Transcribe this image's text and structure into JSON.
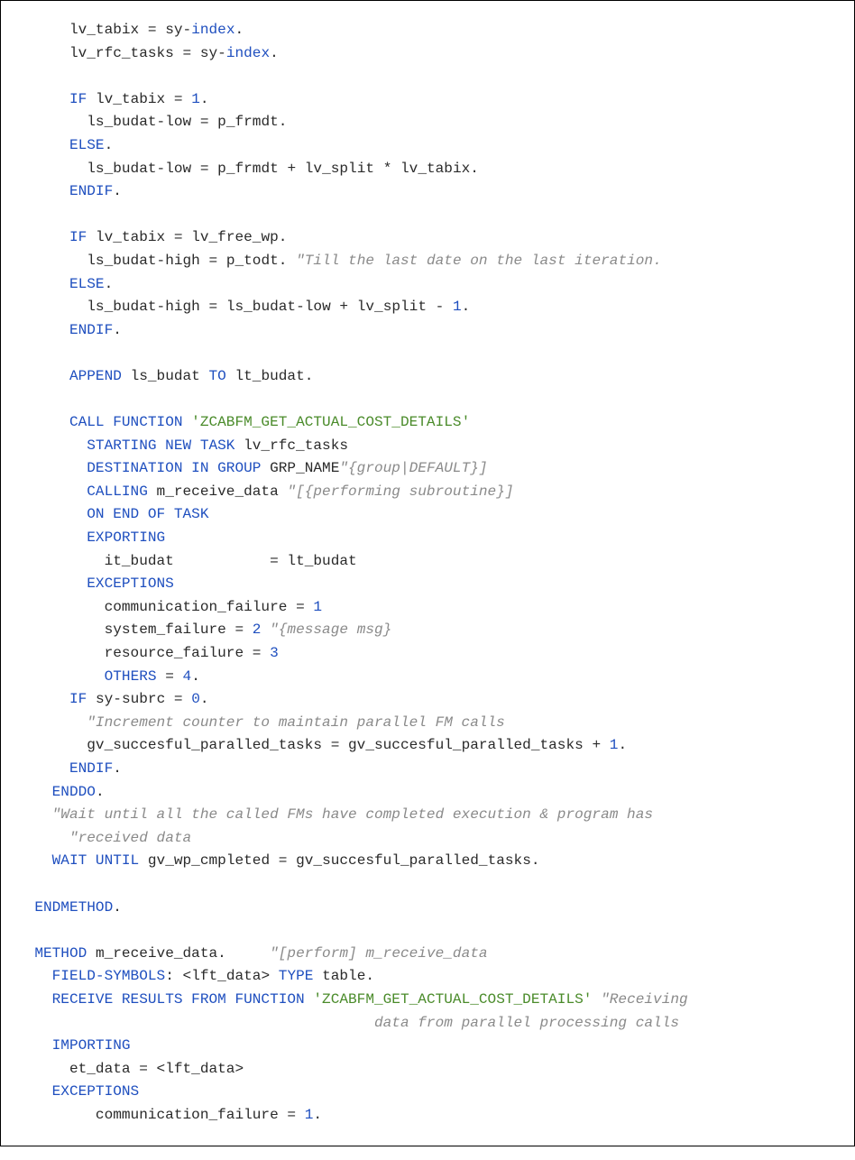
{
  "code": {
    "lines": [
      [
        [
          "id",
          "      lv_tabix "
        ],
        [
          "op",
          "= "
        ],
        [
          "id",
          "sy"
        ],
        [
          "op",
          "-"
        ],
        [
          "kw",
          "index"
        ],
        [
          "op",
          "."
        ]
      ],
      [
        [
          "id",
          "      lv_rfc_tasks "
        ],
        [
          "op",
          "= "
        ],
        [
          "id",
          "sy"
        ],
        [
          "op",
          "-"
        ],
        [
          "kw",
          "index"
        ],
        [
          "op",
          "."
        ]
      ],
      [
        [
          "id",
          ""
        ]
      ],
      [
        [
          "id",
          "      "
        ],
        [
          "kw",
          "IF"
        ],
        [
          "id",
          " lv_tabix "
        ],
        [
          "op",
          "= "
        ],
        [
          "num",
          "1"
        ],
        [
          "op",
          "."
        ]
      ],
      [
        [
          "id",
          "        ls_budat"
        ],
        [
          "op",
          "-"
        ],
        [
          "id",
          "low "
        ],
        [
          "op",
          "= "
        ],
        [
          "id",
          "p_frmdt"
        ],
        [
          "op",
          "."
        ]
      ],
      [
        [
          "id",
          "      "
        ],
        [
          "kw",
          "ELSE"
        ],
        [
          "op",
          "."
        ]
      ],
      [
        [
          "id",
          "        ls_budat"
        ],
        [
          "op",
          "-"
        ],
        [
          "id",
          "low "
        ],
        [
          "op",
          "= "
        ],
        [
          "id",
          "p_frmdt "
        ],
        [
          "op",
          "+ "
        ],
        [
          "id",
          "lv_split "
        ],
        [
          "op",
          "* "
        ],
        [
          "id",
          "lv_tabix"
        ],
        [
          "op",
          "."
        ]
      ],
      [
        [
          "id",
          "      "
        ],
        [
          "kw",
          "ENDIF"
        ],
        [
          "op",
          "."
        ]
      ],
      [
        [
          "id",
          ""
        ]
      ],
      [
        [
          "id",
          "      "
        ],
        [
          "kw",
          "IF"
        ],
        [
          "id",
          " lv_tabix "
        ],
        [
          "op",
          "= "
        ],
        [
          "id",
          "lv_free_wp"
        ],
        [
          "op",
          "."
        ]
      ],
      [
        [
          "id",
          "        ls_budat"
        ],
        [
          "op",
          "-"
        ],
        [
          "id",
          "high "
        ],
        [
          "op",
          "= "
        ],
        [
          "id",
          "p_todt"
        ],
        [
          "op",
          ". "
        ],
        [
          "cmt",
          "\"Till the last date on the last iteration."
        ]
      ],
      [
        [
          "id",
          "      "
        ],
        [
          "kw",
          "ELSE"
        ],
        [
          "op",
          "."
        ]
      ],
      [
        [
          "id",
          "        ls_budat"
        ],
        [
          "op",
          "-"
        ],
        [
          "id",
          "high "
        ],
        [
          "op",
          "= "
        ],
        [
          "id",
          "ls_budat"
        ],
        [
          "op",
          "-"
        ],
        [
          "id",
          "low "
        ],
        [
          "op",
          "+ "
        ],
        [
          "id",
          "lv_split "
        ],
        [
          "op",
          "- "
        ],
        [
          "num",
          "1"
        ],
        [
          "op",
          "."
        ]
      ],
      [
        [
          "id",
          "      "
        ],
        [
          "kw",
          "ENDIF"
        ],
        [
          "op",
          "."
        ]
      ],
      [
        [
          "id",
          ""
        ]
      ],
      [
        [
          "id",
          "      "
        ],
        [
          "kw",
          "APPEND"
        ],
        [
          "id",
          " ls_budat "
        ],
        [
          "kw",
          "TO"
        ],
        [
          "id",
          " lt_budat"
        ],
        [
          "op",
          "."
        ]
      ],
      [
        [
          "id",
          ""
        ]
      ],
      [
        [
          "id",
          "      "
        ],
        [
          "kw",
          "CALL FUNCTION "
        ],
        [
          "str",
          "'ZCABFM_GET_ACTUAL_COST_DETAILS'"
        ]
      ],
      [
        [
          "id",
          "        "
        ],
        [
          "kw",
          "STARTING NEW TASK"
        ],
        [
          "id",
          " lv_rfc_tasks"
        ]
      ],
      [
        [
          "id",
          "        "
        ],
        [
          "kw",
          "DESTINATION IN GROUP"
        ],
        [
          "id",
          " GRP_NAME"
        ],
        [
          "cmt",
          "\"{group|DEFAULT}]"
        ]
      ],
      [
        [
          "id",
          "        "
        ],
        [
          "kw",
          "CALLING"
        ],
        [
          "id",
          " m_receive_data "
        ],
        [
          "cmt",
          "\"[{performing subroutine}]"
        ]
      ],
      [
        [
          "id",
          "        "
        ],
        [
          "kw",
          "ON END OF TASK"
        ]
      ],
      [
        [
          "id",
          "        "
        ],
        [
          "kw",
          "EXPORTING"
        ]
      ],
      [
        [
          "id",
          "          it_budat           "
        ],
        [
          "op",
          "= "
        ],
        [
          "id",
          "lt_budat"
        ]
      ],
      [
        [
          "id",
          "        "
        ],
        [
          "kw",
          "EXCEPTIONS"
        ]
      ],
      [
        [
          "id",
          "          communication_failure "
        ],
        [
          "op",
          "= "
        ],
        [
          "num",
          "1"
        ]
      ],
      [
        [
          "id",
          "          system_failure "
        ],
        [
          "op",
          "= "
        ],
        [
          "num",
          "2 "
        ],
        [
          "cmt",
          "\"{message msg}"
        ]
      ],
      [
        [
          "id",
          "          resource_failure "
        ],
        [
          "op",
          "= "
        ],
        [
          "num",
          "3"
        ]
      ],
      [
        [
          "id",
          "          "
        ],
        [
          "kw",
          "OTHERS "
        ],
        [
          "op",
          "= "
        ],
        [
          "num",
          "4"
        ],
        [
          "op",
          "."
        ]
      ],
      [
        [
          "id",
          "      "
        ],
        [
          "kw",
          "IF"
        ],
        [
          "id",
          " sy"
        ],
        [
          "op",
          "-"
        ],
        [
          "id",
          "subrc "
        ],
        [
          "op",
          "= "
        ],
        [
          "num",
          "0"
        ],
        [
          "op",
          "."
        ]
      ],
      [
        [
          "id",
          "        "
        ],
        [
          "cmt",
          "\"Increment counter to maintain parallel FM calls"
        ]
      ],
      [
        [
          "id",
          "        gv_succesful_paralled_tasks "
        ],
        [
          "op",
          "= "
        ],
        [
          "id",
          "gv_succesful_paralled_tasks "
        ],
        [
          "op",
          "+ "
        ],
        [
          "num",
          "1"
        ],
        [
          "op",
          "."
        ]
      ],
      [
        [
          "id",
          "      "
        ],
        [
          "kw",
          "ENDIF"
        ],
        [
          "op",
          "."
        ]
      ],
      [
        [
          "id",
          "    "
        ],
        [
          "kw",
          "ENDDO"
        ],
        [
          "op",
          "."
        ]
      ],
      [
        [
          "id",
          "    "
        ],
        [
          "cmt",
          "\"Wait until all the called FMs have completed execution & program has"
        ]
      ],
      [
        [
          "id",
          "      "
        ],
        [
          "cmt",
          "\"received data"
        ]
      ],
      [
        [
          "id",
          "    "
        ],
        [
          "kw",
          "WAIT UNTIL"
        ],
        [
          "id",
          " gv_wp_cmpleted "
        ],
        [
          "op",
          "= "
        ],
        [
          "id",
          "gv_succesful_paralled_tasks"
        ],
        [
          "op",
          "."
        ]
      ],
      [
        [
          "id",
          ""
        ]
      ],
      [
        [
          "id",
          "  "
        ],
        [
          "kw",
          "ENDMETHOD"
        ],
        [
          "op",
          "."
        ]
      ],
      [
        [
          "id",
          ""
        ]
      ],
      [
        [
          "id",
          "  "
        ],
        [
          "kw",
          "METHOD"
        ],
        [
          "id",
          " m_receive_data"
        ],
        [
          "op",
          ".     "
        ],
        [
          "cmt",
          "\"[perform] m_receive_data"
        ]
      ],
      [
        [
          "id",
          "    "
        ],
        [
          "kw",
          "FIELD-SYMBOLS"
        ],
        [
          "op",
          ": "
        ],
        [
          "id",
          "<lft_data> "
        ],
        [
          "kw",
          "TYPE"
        ],
        [
          "id",
          " table"
        ],
        [
          "op",
          "."
        ]
      ],
      [
        [
          "id",
          "    "
        ],
        [
          "kw",
          "RECEIVE RESULTS FROM FUNCTION "
        ],
        [
          "str",
          "'ZCABFM_GET_ACTUAL_COST_DETAILS' "
        ],
        [
          "cmt",
          "\"Receiving"
        ]
      ],
      [
        [
          "id",
          "                                         "
        ],
        [
          "cmt",
          "data from parallel processing calls"
        ]
      ],
      [
        [
          "id",
          "    "
        ],
        [
          "kw",
          "IMPORTING"
        ]
      ],
      [
        [
          "id",
          "      et_data "
        ],
        [
          "op",
          "= "
        ],
        [
          "id",
          "<lft_data>"
        ]
      ],
      [
        [
          "id",
          "    "
        ],
        [
          "kw",
          "EXCEPTIONS"
        ]
      ],
      [
        [
          "id",
          "         communication_failure "
        ],
        [
          "op",
          "= "
        ],
        [
          "num",
          "1"
        ],
        [
          "op",
          "."
        ]
      ]
    ]
  }
}
